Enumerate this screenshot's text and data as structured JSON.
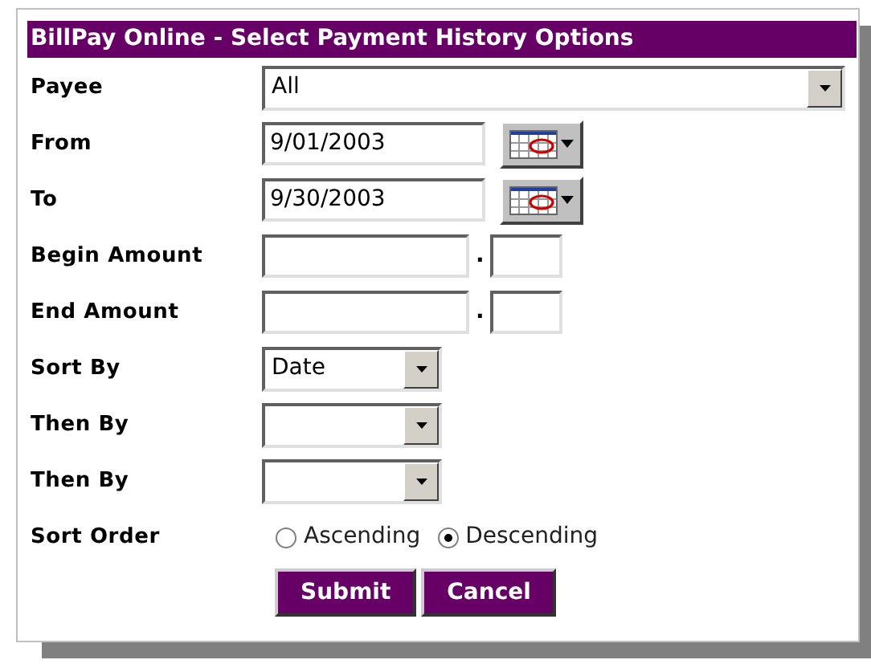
{
  "title": "BillPay Online - Select Payment History Options",
  "rows": [
    {
      "kind": "wide_select",
      "label": "Payee",
      "value": "All"
    },
    {
      "kind": "date",
      "label": "From",
      "value": "9/01/2003"
    },
    {
      "kind": "date",
      "label": "To",
      "value": "9/30/2003"
    },
    {
      "kind": "amount",
      "label": "Begin Amount",
      "separator": "."
    },
    {
      "kind": "amount",
      "label": "End Amount",
      "separator": "."
    },
    {
      "kind": "select",
      "label": "Sort By",
      "value": "Date"
    },
    {
      "kind": "select",
      "label": "Then By"
    },
    {
      "kind": "select",
      "label": "Then By"
    },
    {
      "kind": "radio",
      "label": "Sort Order",
      "options": [
        {
          "label": "Ascending",
          "selected": false
        },
        {
          "label": "Descending",
          "selected": true
        }
      ]
    }
  ],
  "buttons": [
    "Submit",
    "Cancel"
  ]
}
